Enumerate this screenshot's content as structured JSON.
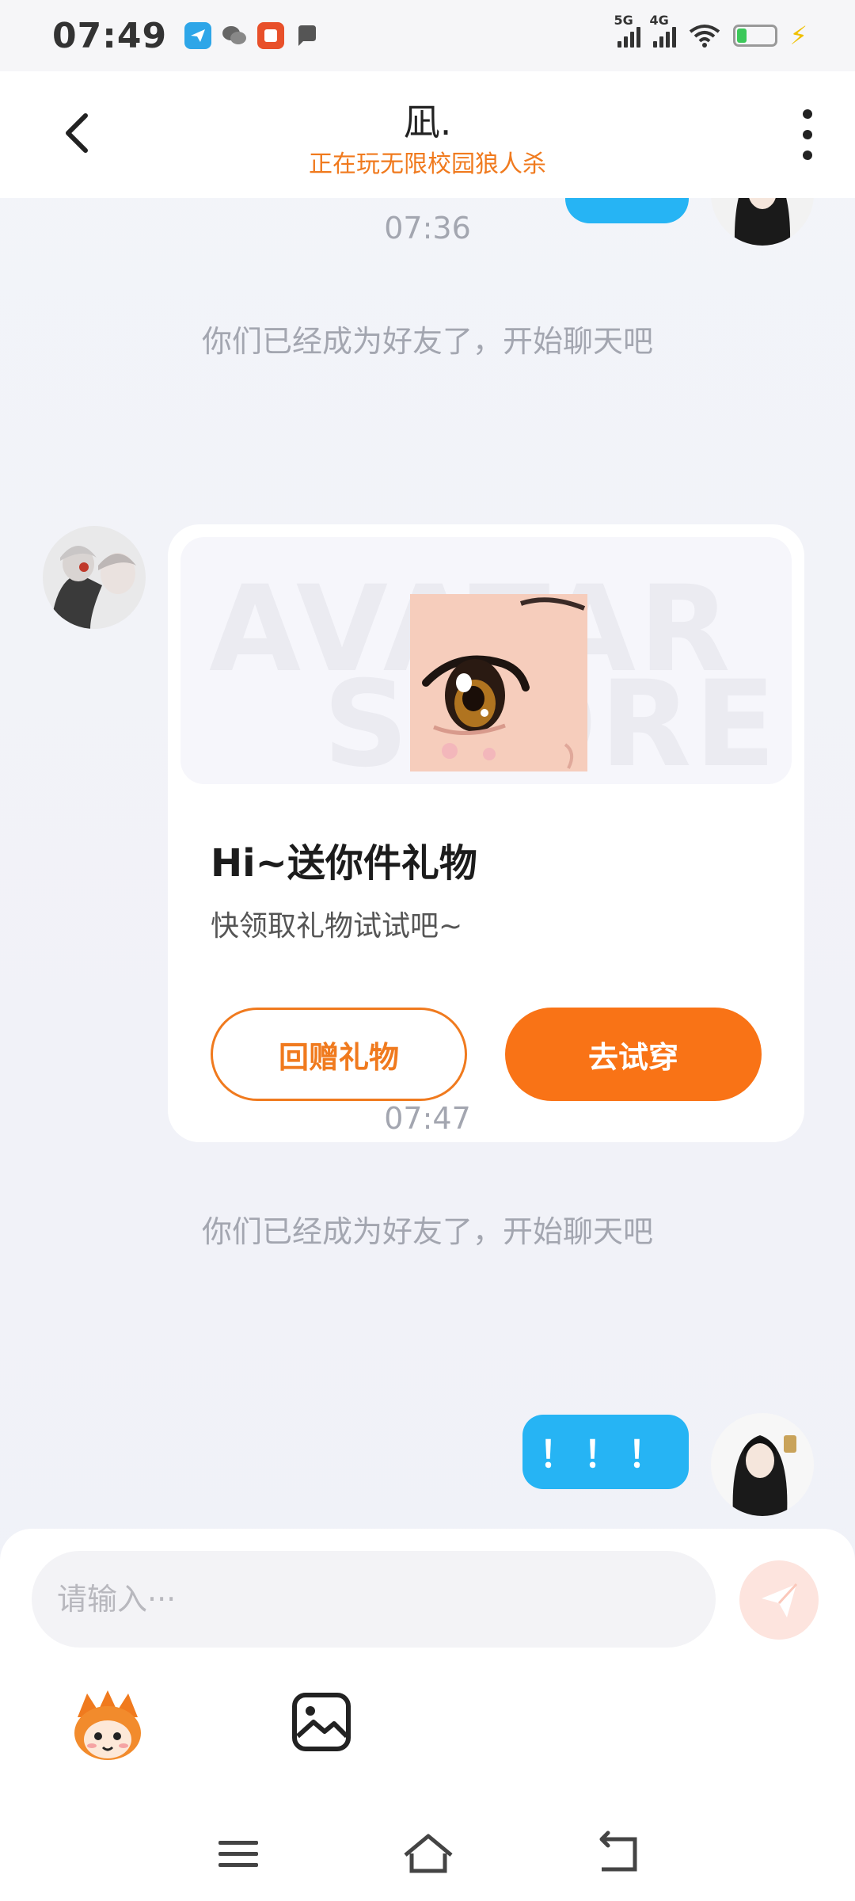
{
  "status_bar": {
    "time": "07:49",
    "signal_1": "5G",
    "signal_2": "4G",
    "battery_level": 0.25,
    "charging": true
  },
  "header": {
    "title": "凪.",
    "subtitle": "正在玩无限校园狼人杀"
  },
  "chat": {
    "messages": [
      {
        "type": "timestamp",
        "text": "07:36"
      },
      {
        "type": "system",
        "text": "你们已经成为好友了，开始聊天吧"
      },
      {
        "type": "gift_card",
        "title": "Hi~送你件礼物",
        "subtitle": "快领取礼物试试吧~",
        "watermark_line1": "AVATAR",
        "watermark_line2": "STORE",
        "button_return": "回赠礼物",
        "button_try": "去试穿"
      },
      {
        "type": "timestamp",
        "text": "07:47"
      },
      {
        "type": "system",
        "text": "你们已经成为好友了，开始聊天吧"
      },
      {
        "type": "self_text",
        "text": "！！！"
      }
    ]
  },
  "input": {
    "placeholder": "请输入···"
  },
  "colors": {
    "accent_orange": "#f97316",
    "subtitle_orange": "#f07a1e",
    "bubble_blue": "#26b4f4",
    "system_text": "#a3a6b0"
  },
  "icons": {
    "back": "chevron-left-icon",
    "more": "more-vertical-icon",
    "send": "paper-plane-icon",
    "emoji": "mascot-emoji-icon",
    "image": "image-icon",
    "nav_menu": "menu-icon",
    "nav_home": "home-icon",
    "nav_back": "back-icon"
  }
}
